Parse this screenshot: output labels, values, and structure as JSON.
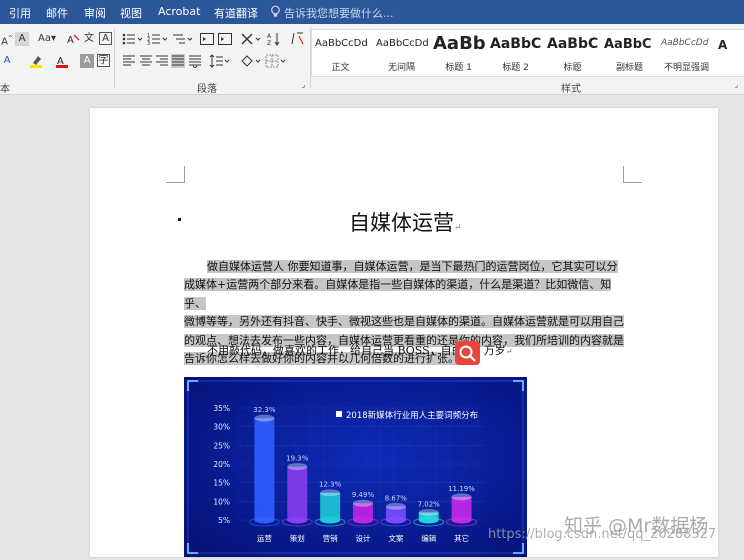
{
  "menu": {
    "items": [
      "引用",
      "邮件",
      "审阅",
      "视图",
      "Acrobat",
      "有道翻译"
    ],
    "tell_me": "告诉我您想要做什么..."
  },
  "ribbon": {
    "font_group_label": "本",
    "paragraph_group_label": "段落",
    "styles_group_label": "样式",
    "styles": [
      {
        "sample": "AaBbCcDd",
        "name": "正文"
      },
      {
        "sample": "AaBbCcDd",
        "name": "无间隔"
      },
      {
        "sample": "AaBb",
        "name": "标题 1"
      },
      {
        "sample": "AaBbC",
        "name": "标题 2"
      },
      {
        "sample": "AaBbC",
        "name": "标题"
      },
      {
        "sample": "AaBbC",
        "name": "副标题"
      },
      {
        "sample": "AaBbCcDd",
        "name": "不明显强调"
      }
    ]
  },
  "document": {
    "title": "自媒体运营",
    "paragraph_lines": [
      "做自媒体运营人 你要知道事，自媒体运营，是当下最热门的运营岗位，它其实可以分",
      "成媒体+运营两个部分来看。自媒体是指一些自媒体的渠道，什么是渠道？比如微信、知乎、",
      "微博等等，另外还有抖音、快手、微视这些也是自媒体的渠道。自媒体运营就是可以用自己",
      "的观点、想法去发布一些内容，自媒体运营更看重的还是你的内容，我们所培训的内容就是",
      "告诉你怎么样去做好你的内容并以几何倍数的进行扩张。"
    ],
    "second_line_before": "不用敲代码，做喜欢的工作，给自己当 BOSS，自由",
    "second_line_after": "万岁"
  },
  "chart_data": {
    "type": "bar",
    "title": "2018新媒体行业用人主要词频分布",
    "categories": [
      "运营",
      "策划",
      "营销",
      "设计",
      "文案",
      "编辑",
      "其它"
    ],
    "values": [
      32.3,
      19.3,
      12.3,
      9.49,
      8.67,
      7.02,
      11.19
    ],
    "value_labels": [
      "32.3%",
      "19.3%",
      "12.3%",
      "9.49%",
      "8.67%",
      "7.02%",
      "11.19%"
    ],
    "yticks": [
      "35%",
      "30%",
      "25%",
      "20%",
      "15%",
      "10%",
      "5%"
    ],
    "ylim": [
      5,
      35
    ],
    "colors": [
      "#2f5dff",
      "#8a3ef0",
      "#1fc8d8",
      "#c025e6",
      "#7a4bff",
      "#22d6e0",
      "#c52ae8"
    ],
    "grid": true
  },
  "watermark": {
    "url": "https://blog.csdn.net/qq_20288327",
    "zhihu": "知乎 @Mr数据杨"
  }
}
